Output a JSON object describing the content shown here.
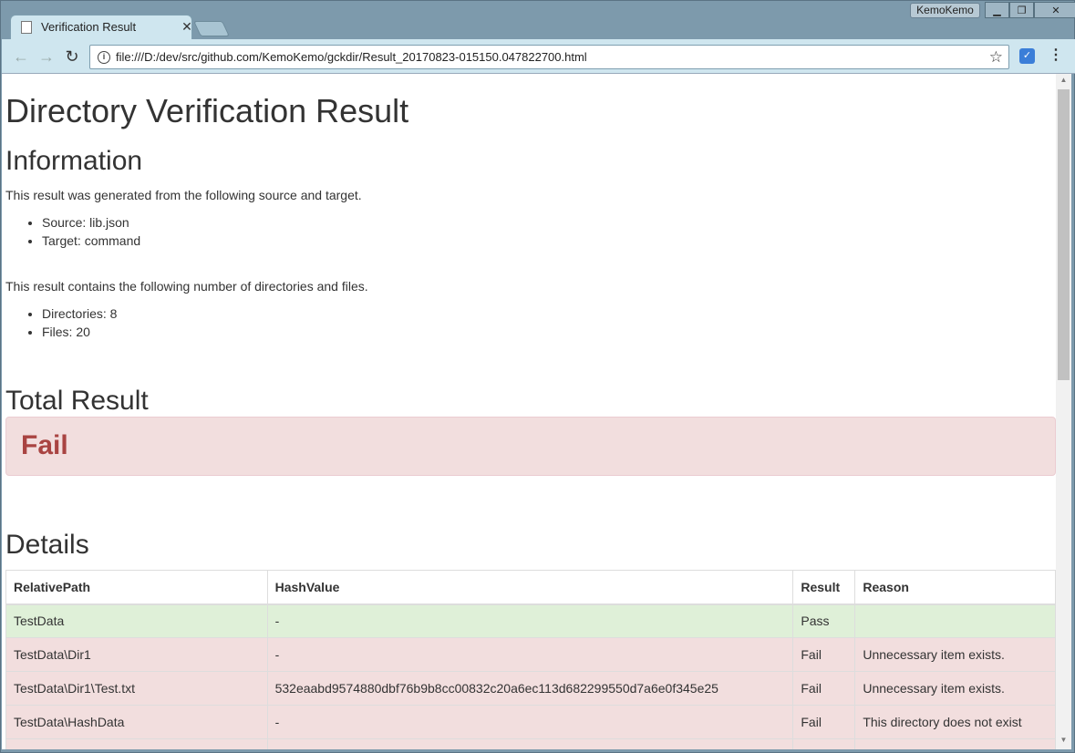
{
  "window": {
    "profile_name": "KemoKemo",
    "minimize": "▁",
    "maximize": "❐",
    "close": "✕"
  },
  "tab": {
    "title": "Verification Result",
    "close": "✕"
  },
  "toolbar": {
    "back": "←",
    "forward": "→",
    "reload": "↻",
    "info": "i",
    "url": "file:///D:/dev/src/github.com/KemoKemo/gckdir/Result_20170823-015150.047822700.html",
    "star": "☆",
    "extension": "✓",
    "menu": "⋮"
  },
  "page": {
    "title": "Directory Verification Result",
    "information": {
      "heading": "Information",
      "intro": "This result was generated from the following source and target.",
      "items": [
        "Source: lib.json",
        "Target: command"
      ],
      "count_intro": "This result contains the following number of directories and files.",
      "count_items": [
        "Directories: 8",
        "Files: 20"
      ]
    },
    "total": {
      "heading": "Total Result",
      "result": "Fail"
    },
    "details": {
      "heading": "Details",
      "columns": [
        "RelativePath",
        "HashValue",
        "Result",
        "Reason"
      ],
      "rows": [
        {
          "path": "TestData",
          "hash": "-",
          "result": "Pass",
          "reason": "",
          "status": "pass"
        },
        {
          "path": "TestData\\Dir1",
          "hash": "-",
          "result": "Fail",
          "reason": "Unnecessary item exists.",
          "status": "fail"
        },
        {
          "path": "TestData\\Dir1\\Test.txt",
          "hash": "532eaabd9574880dbf76b9b8cc00832c20a6ec113d682299550d7a6e0f345e25",
          "result": "Fail",
          "reason": "Unnecessary item exists.",
          "status": "fail"
        },
        {
          "path": "TestData\\HashData",
          "hash": "-",
          "result": "Fail",
          "reason": "This directory does not exist",
          "status": "fail"
        },
        {
          "path": "",
          "hash": "",
          "result": "",
          "reason": "",
          "status": "fail"
        }
      ]
    }
  },
  "colors": {
    "pass_bg": "#dff0d8",
    "fail_bg": "#f2dede",
    "fail_text": "#a94442"
  }
}
